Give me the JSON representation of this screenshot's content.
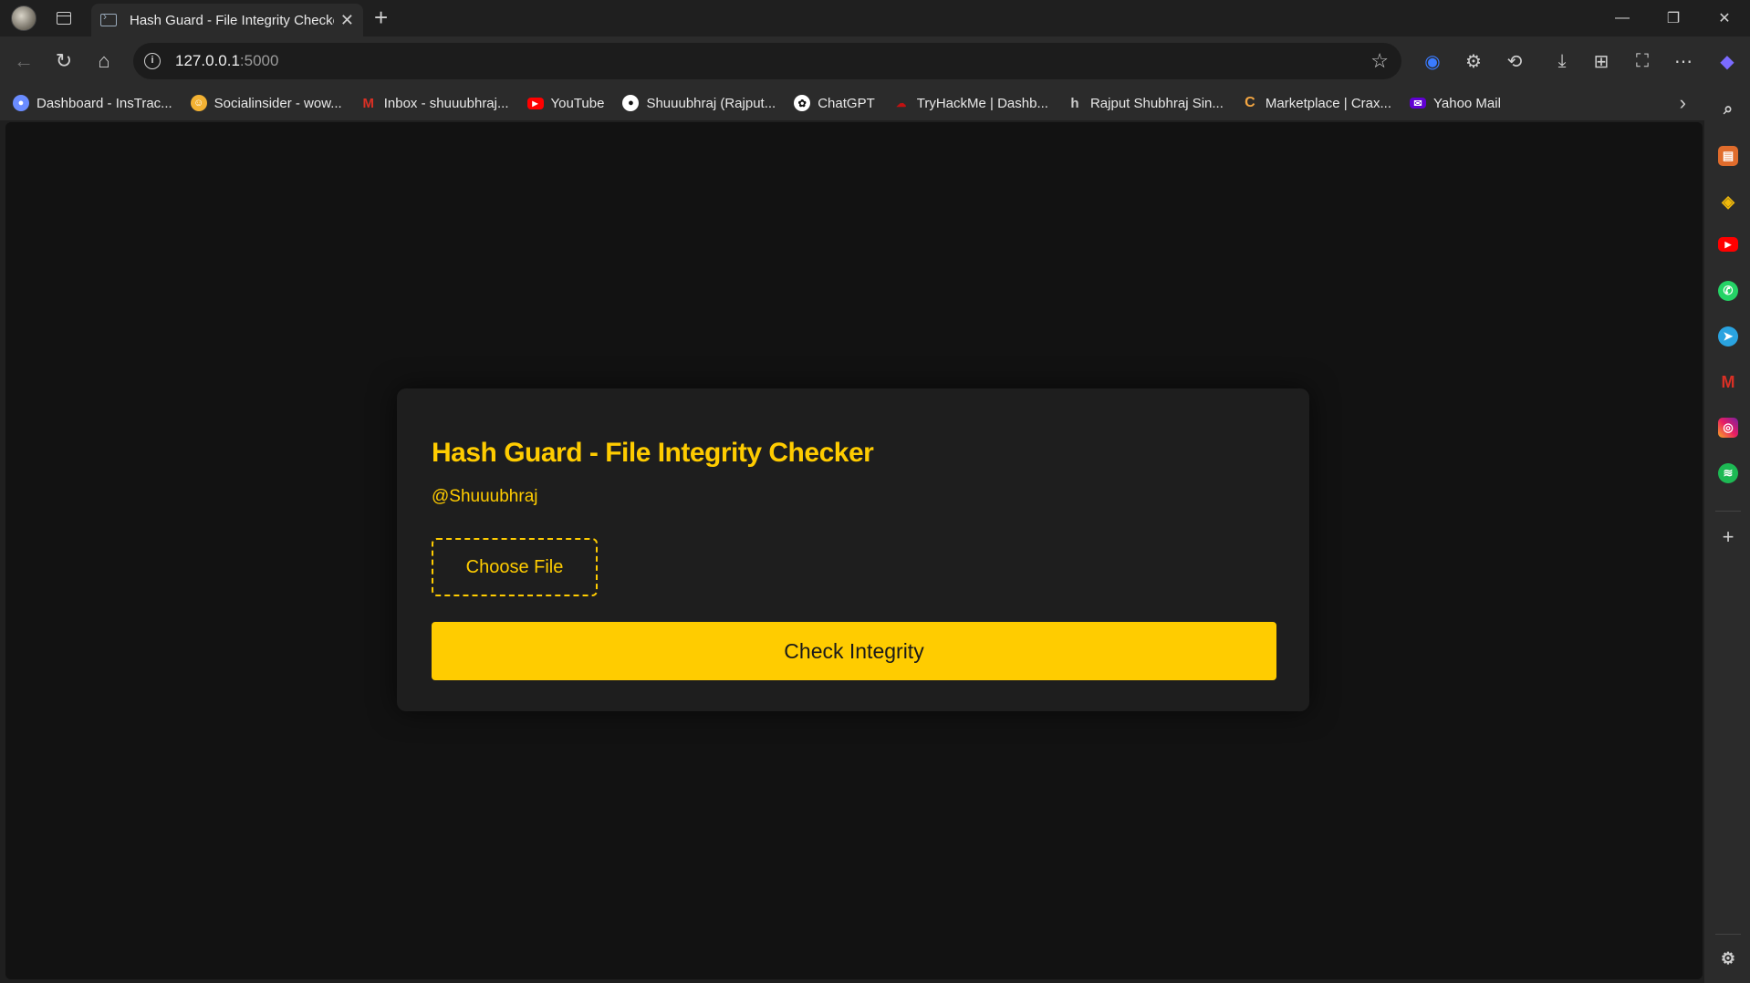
{
  "tab": {
    "title": "Hash Guard - File Integrity Checker"
  },
  "address_bar": {
    "host": "127.0.0.1",
    "port": ":5000"
  },
  "bookmarks": [
    {
      "label": "Dashboard - InsTrac...",
      "icon": "instrack-icon",
      "color": "#6a8cff"
    },
    {
      "label": "Socialinsider - wow...",
      "icon": "socialinsider-icon",
      "color": "#f3b233"
    },
    {
      "label": "Inbox - shuuubhraj...",
      "icon": "gmail-icon",
      "color": "#d93025"
    },
    {
      "label": "YouTube",
      "icon": "youtube-icon",
      "color": "#ff0000"
    },
    {
      "label": "Shuuubhraj (Rajput...",
      "icon": "github-icon",
      "color": "#ffffff"
    },
    {
      "label": "ChatGPT",
      "icon": "chatgpt-icon",
      "color": "#ffffff"
    },
    {
      "label": "TryHackMe | Dashb...",
      "icon": "tryhackme-icon",
      "color": "#c11111"
    },
    {
      "label": "Rajput Shubhraj Sin...",
      "icon": "h-icon",
      "color": "#333333"
    },
    {
      "label": "Marketplace | Crax...",
      "icon": "crax-icon",
      "color": "#f5a742"
    },
    {
      "label": "Yahoo Mail",
      "icon": "yahoo-mail-icon",
      "color": "#6001d2"
    }
  ],
  "page": {
    "heading": "Hash Guard - File Integrity Checker",
    "handle": "@Shuuubhraj",
    "choose_file_label": "Choose File",
    "check_button_label": "Check Integrity"
  },
  "colors": {
    "accent": "#ffcc00",
    "page_bg": "#121212",
    "card_bg": "#1e1e1e"
  }
}
